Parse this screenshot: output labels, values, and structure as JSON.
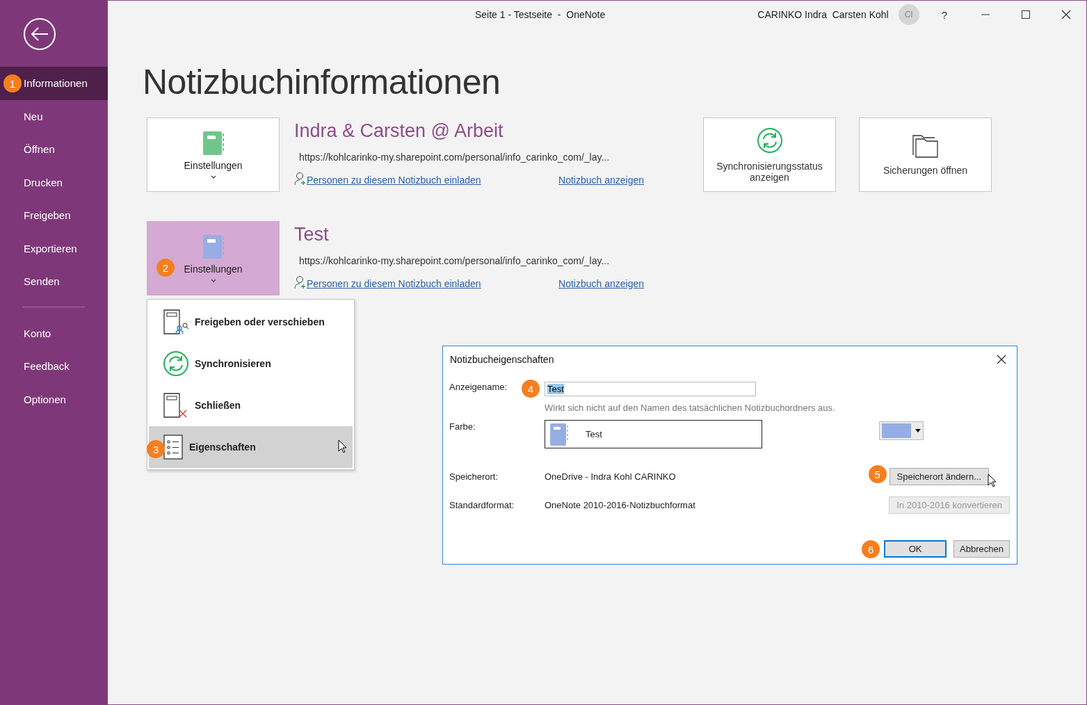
{
  "window": {
    "title": "Seite 1 - Testseite  -  OneNote",
    "user": "CARINKO Indra  Carsten Kohl",
    "avatar": "CI",
    "help": "?"
  },
  "sidebar": {
    "items": [
      {
        "label": "Informationen",
        "selected": true,
        "badge": "1"
      },
      {
        "label": "Neu",
        "selected": false
      },
      {
        "label": "Öffnen",
        "selected": false
      },
      {
        "label": "Drucken",
        "selected": false
      },
      {
        "label": "Freigeben",
        "selected": false
      },
      {
        "label": "Exportieren",
        "selected": false
      },
      {
        "label": "Senden",
        "selected": false
      }
    ],
    "lower_items": [
      {
        "label": "Konto",
        "selected": false
      },
      {
        "label": "Feedback",
        "selected": false
      },
      {
        "label": "Optionen",
        "selected": false
      }
    ]
  },
  "heading": "Notizbuchinformationen",
  "notebooks": [
    {
      "name": "Indra & Carsten @ Arbeit",
      "color": "#6fc68c",
      "selected": false,
      "settings_label": "Einstellungen",
      "url": "https://kohlcarinko-my.sharepoint.com/personal/info_carinko_com/_lay...",
      "invite_link": "Personen zu diesem Notizbuch einladen",
      "show_link": "Notizbuch anzeigen"
    },
    {
      "name": "Test",
      "color": "#97aee4",
      "selected": true,
      "badge": "2",
      "settings_label": "Einstellungen",
      "url": "https://kohlcarinko-my.sharepoint.com/personal/info_carinko_com/_lay...",
      "invite_link": "Personen zu diesem Notizbuch einladen",
      "show_link": "Notizbuch anzeigen"
    }
  ],
  "actions": [
    {
      "kind": "sync",
      "label": "Synchronisierungsstatus anzeigen"
    },
    {
      "kind": "folder",
      "label": "Sicherungen öffnen"
    }
  ],
  "menu": {
    "items": [
      {
        "kind": "share",
        "label": "Freigeben oder verschieben",
        "selected": false
      },
      {
        "kind": "sync",
        "label": "Synchronisieren",
        "selected": false
      },
      {
        "kind": "close",
        "label": "Schließen",
        "selected": false
      },
      {
        "kind": "properties",
        "label": "Eigenschaften",
        "selected": true,
        "badge": "3"
      }
    ]
  },
  "dialog": {
    "title": "Notizbucheigenschaften",
    "name_label": "Anzeigename:",
    "name_value": "Test",
    "name_selected": true,
    "name_badge": "4",
    "name_hint": "Wirkt sich nicht auf den Namen des tatsächlichen Notizbuchordners aus.",
    "color_label": "Farbe:",
    "color_preview": "Test",
    "location_label": "Speicherort:",
    "location_value": "OneDrive - Indra Kohl CARINKO",
    "location_button": {
      "label": "Speicherort ändern...",
      "badge": "5",
      "disabled": false
    },
    "format_label": "Standardformat:",
    "format_value": "OneNote 2010-2016-Notizbuchformat",
    "convert_button": {
      "label": "In 2010-2016 konvertieren",
      "disabled": true
    },
    "buttons": [
      {
        "label": "OK",
        "default": true,
        "badge": "6"
      },
      {
        "label": "Abbrechen",
        "default": false
      }
    ]
  }
}
